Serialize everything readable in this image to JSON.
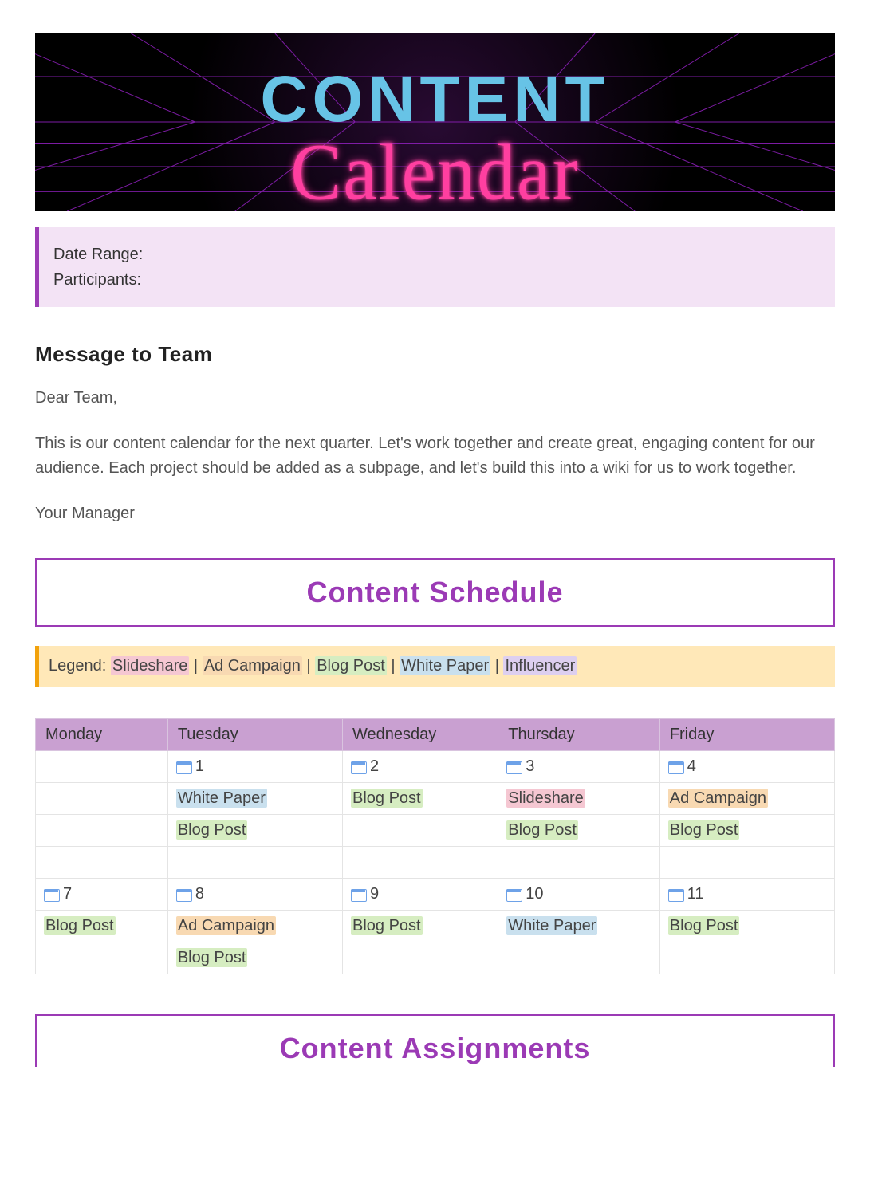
{
  "banner": {
    "title": "CONTENT",
    "script": "Calendar"
  },
  "info": {
    "date_range_label": "Date Range:",
    "participants_label": "Participants:"
  },
  "message": {
    "heading": "Message to Team",
    "greeting": "Dear Team,",
    "body": "This is our content calendar for the next quarter. Let's work together and create great, engaging content for our audience. Each project should be added as a subpage, and let's build this into a wiki for us to work together.",
    "signoff": "Your Manager"
  },
  "schedule": {
    "heading": "Content Schedule",
    "legend_label": "Legend:",
    "legend": [
      {
        "label": "Slideshare",
        "class": "c-slide"
      },
      {
        "label": "Ad Campaign",
        "class": "c-ad"
      },
      {
        "label": "Blog Post",
        "class": "c-blog"
      },
      {
        "label": "White Paper",
        "class": "c-white"
      },
      {
        "label": "Influencer",
        "class": "c-influ"
      }
    ],
    "days": [
      "Monday",
      "Tuesday",
      "Wednesday",
      "Thursday",
      "Friday"
    ],
    "rows": [
      {
        "type": "date",
        "cells": [
          null,
          "1",
          "2",
          "3",
          "4"
        ]
      },
      {
        "type": "task",
        "cells": [
          null,
          {
            "t": "White Paper",
            "c": "c-white"
          },
          {
            "t": "Blog Post",
            "c": "c-blog"
          },
          {
            "t": "Slideshare",
            "c": "c-slide"
          },
          {
            "t": "Ad Campaign",
            "c": "c-ad"
          }
        ]
      },
      {
        "type": "task",
        "cells": [
          null,
          {
            "t": "Blog Post",
            "c": "c-blog"
          },
          null,
          {
            "t": "Blog Post",
            "c": "c-blog"
          },
          {
            "t": "Blog Post",
            "c": "c-blog"
          }
        ]
      },
      {
        "type": "blank",
        "cells": [
          null,
          null,
          null,
          null,
          null
        ]
      },
      {
        "type": "date",
        "cells": [
          "7",
          "8",
          "9",
          "10",
          "11"
        ]
      },
      {
        "type": "task",
        "cells": [
          {
            "t": "Blog Post",
            "c": "c-blog"
          },
          {
            "t": "Ad Campaign",
            "c": "c-ad"
          },
          {
            "t": "Blog Post",
            "c": "c-blog"
          },
          {
            "t": "White Paper",
            "c": "c-white"
          },
          {
            "t": "Blog Post",
            "c": "c-blog"
          }
        ]
      },
      {
        "type": "task",
        "cells": [
          null,
          {
            "t": "Blog Post",
            "c": "c-blog"
          },
          null,
          null,
          null
        ]
      }
    ]
  },
  "assignments": {
    "heading": "Content Assignments"
  }
}
